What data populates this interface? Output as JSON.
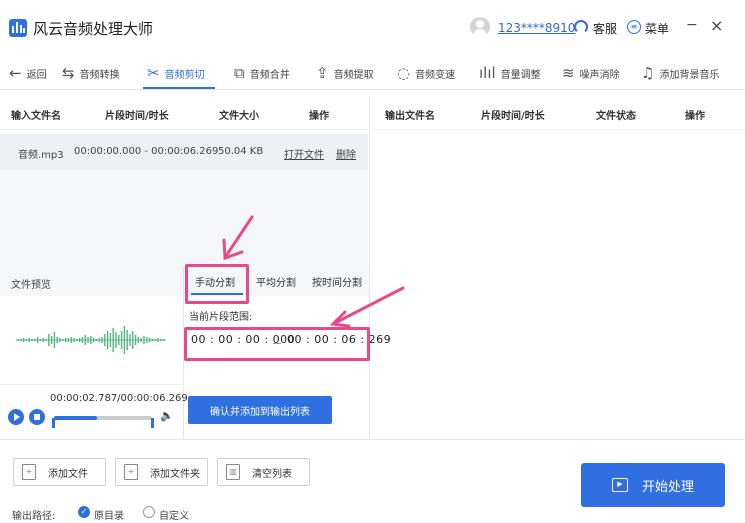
{
  "app": {
    "title": "风云音频处理大师",
    "username": "123****8910",
    "service_label": "客服",
    "menu_label": "菜单",
    "minimize_glyph": "−",
    "close_glyph": "×"
  },
  "toolbar": {
    "back": "返回",
    "items": [
      "音频转换",
      "音频剪切",
      "音频合并",
      "音频提取",
      "音频变速",
      "音量调整",
      "噪声消除",
      "添加背景音乐"
    ],
    "active_index": 1
  },
  "input_table": {
    "headers": [
      "输入文件名",
      "片段时间/时长",
      "文件大小",
      "操作"
    ],
    "rows": [
      {
        "name": "音频.mp3",
        "range": "00:00:00.000 - 00:00:06.269",
        "size": "50.04 KB",
        "open": "打开文件",
        "delete": "删除"
      }
    ]
  },
  "output_table": {
    "headers": [
      "输出文件名",
      "片段时间/时长",
      "文件状态",
      "操作"
    ]
  },
  "preview": {
    "label": "文件预览",
    "time": "00:00:02.787/00:00:06.269",
    "progress": 0.44
  },
  "split": {
    "tabs": [
      "手动分割",
      "平均分割",
      "按时间分割"
    ],
    "active_tab": 0,
    "range_label": "当前片段范围:",
    "start": "00 : 00 : 00 : 000",
    "end": "00 : 00 : 06 : 269",
    "confirm": "确认并添加到输出列表"
  },
  "bottom": {
    "add_file": "添加文件",
    "add_folder": "添加文件夹",
    "clear_list": "清空列表",
    "start": "开始处理",
    "output_path_label": "输出路径:",
    "option_original": "原目录",
    "option_custom": "自定义",
    "selected_option": "原目录"
  },
  "colors": {
    "accent": "#2f6fe0",
    "annotation": "#e54b8b",
    "waveform": "#5fc38a"
  },
  "icons": [
    "logo-icon",
    "avatar-icon",
    "headset-icon",
    "menu-icon",
    "back-arrow-icon",
    "convert-icon",
    "scissors-icon",
    "merge-icon",
    "extract-icon",
    "speed-icon",
    "volume-bars-icon",
    "noise-icon",
    "music-note-icon",
    "play-icon",
    "stop-icon",
    "speaker-icon",
    "add-file-icon",
    "add-folder-icon",
    "trash-icon",
    "start-icon",
    "annotation-arrow"
  ]
}
